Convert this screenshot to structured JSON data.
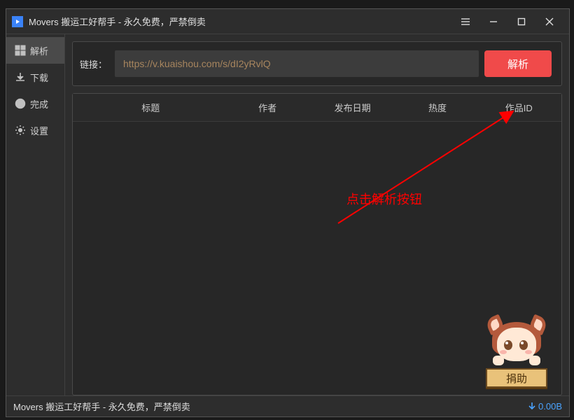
{
  "titlebar": {
    "title": "Movers 搬运工好帮手 - 永久免费，严禁倒卖"
  },
  "sidebar": {
    "items": [
      {
        "label": "解析"
      },
      {
        "label": "下载"
      },
      {
        "label": "完成"
      },
      {
        "label": "设置"
      }
    ]
  },
  "url": {
    "label": "链接：",
    "value": "https://v.kuaishou.com/s/dI2yRvlQ",
    "button": "解析"
  },
  "table": {
    "headers": [
      "标题",
      "作者",
      "发布日期",
      "热度",
      "作品ID"
    ]
  },
  "annotation": "点击解析按钮",
  "donate": {
    "label": "捐助"
  },
  "status": {
    "text": "Movers 搬运工好帮手 - 永久免费，严禁倒卖",
    "speed": "0.00B"
  }
}
